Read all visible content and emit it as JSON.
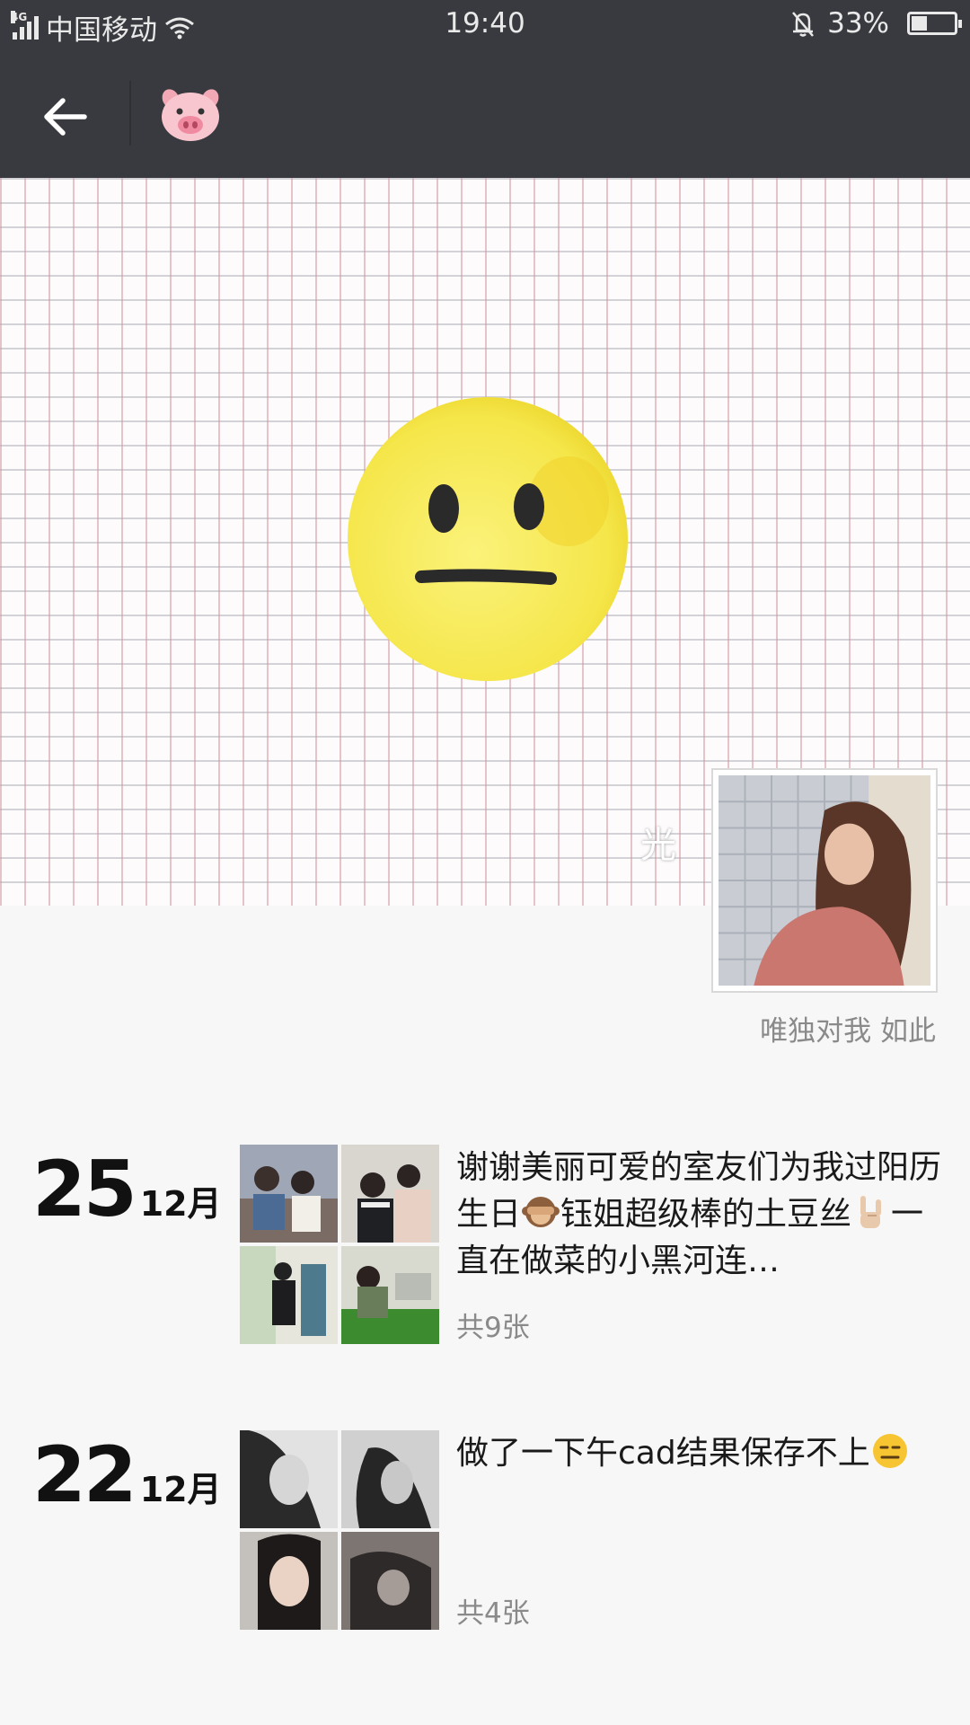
{
  "status_bar": {
    "network": "4G",
    "carrier": "中国移动",
    "time": "19:40",
    "battery_percent": "33%",
    "battery_level": 0.33
  },
  "nav": {
    "back_icon": "arrow-left-icon",
    "avatar_icon": "pig-face-icon"
  },
  "cover": {
    "overlay_text": "光"
  },
  "profile": {
    "signature": "唯独对我 如此"
  },
  "posts": [
    {
      "day": "25",
      "month": "12月",
      "text_parts": [
        "谢谢美丽可爱的室友们为我过阳历生日",
        "钰姐超级棒的土豆丝",
        "一直在做菜的小黑河连…"
      ],
      "emojis": [
        "see-no-evil-monkey-icon",
        "sign-of-horns-icon"
      ],
      "count": "共9张"
    },
    {
      "day": "22",
      "month": "12月",
      "text_parts": [
        "做了一下午cad结果保存不上"
      ],
      "emojis": [
        "expressionless-face-icon"
      ],
      "count": "共4张"
    }
  ],
  "colors": {
    "bar": "#393a3f",
    "background": "#f7f7f7",
    "secondary_text": "#8a8a8a"
  }
}
